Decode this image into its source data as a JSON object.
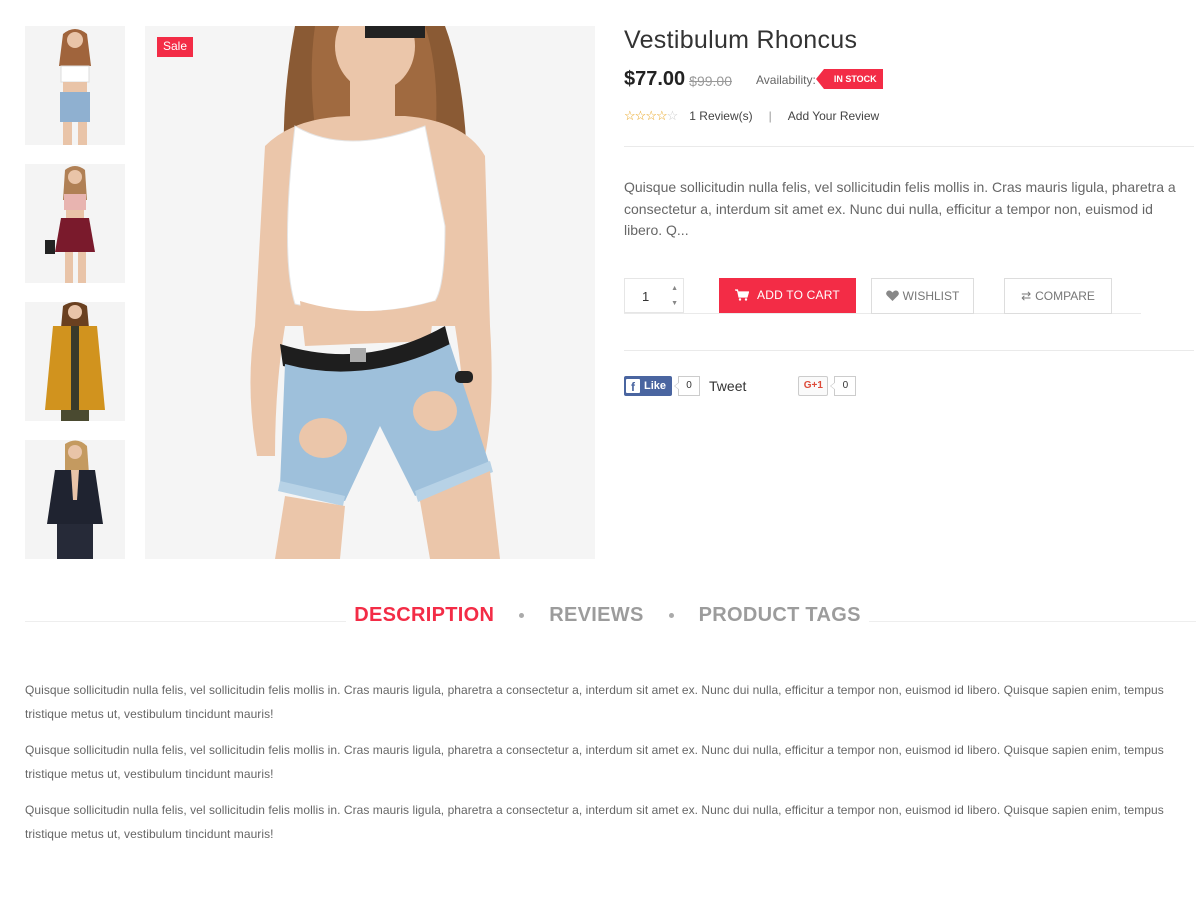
{
  "gallery": {
    "sale_label": "Sale",
    "thumbnails": [
      "thumb-1",
      "thumb-2",
      "thumb-3",
      "thumb-4"
    ]
  },
  "product": {
    "title": "Vestibulum Rhoncus",
    "price": "$77.00",
    "old_price": "$99.00",
    "availability_label": "Availability:",
    "stock_status": "IN STOCK",
    "rating": 4,
    "rating_max": 5,
    "review_count": "1 Review(s)",
    "review_separator": "|",
    "add_review": "Add Your Review",
    "short_description": "Quisque sollicitudin nulla felis, vel sollicitudin felis mollis in. Cras mauris ligula, pharetra a consectetur a, interdum sit amet ex. Nunc dui nulla, efficitur a tempor non, euismod id libero. Q..."
  },
  "cart": {
    "quantity": "1",
    "add_to_cart": "ADD TO CART",
    "wishlist": "WISHLIST",
    "compare": "COMPARE"
  },
  "social": {
    "fb_like": "Like",
    "fb_count": "0",
    "tweet": "Tweet",
    "gplus": "G+1",
    "gplus_count": "0"
  },
  "tabs": {
    "items": [
      "DESCRIPTION",
      "REVIEWS",
      "PRODUCT TAGS"
    ],
    "active": "DESCRIPTION"
  },
  "description": {
    "paragraphs": [
      "Quisque sollicitudin nulla felis, vel sollicitudin felis mollis in. Cras mauris ligula, pharetra a consectetur a, interdum sit amet ex. Nunc dui nulla, efficitur a tempor non, euismod id libero. Quisque sapien enim, tempus tristique metus ut, vestibulum tincidunt mauris!",
      "Quisque sollicitudin nulla felis, vel sollicitudin felis mollis in. Cras mauris ligula, pharetra a consectetur a, interdum sit amet ex. Nunc dui nulla, efficitur a tempor non, euismod id libero. Quisque sapien enim, tempus tristique metus ut, vestibulum tincidunt mauris!",
      "Quisque sollicitudin nulla felis, vel sollicitudin felis mollis in. Cras mauris ligula, pharetra a consectetur a, interdum sit amet ex. Nunc dui nulla, efficitur a tempor non, euismod id libero. Quisque sapien enim, tempus tristique metus ut, vestibulum tincidunt mauris!"
    ]
  },
  "colors": {
    "accent": "#f32c46",
    "text": "#333333",
    "muted": "#999999",
    "facebook": "#4a65a0",
    "star": "#e8a21a"
  }
}
